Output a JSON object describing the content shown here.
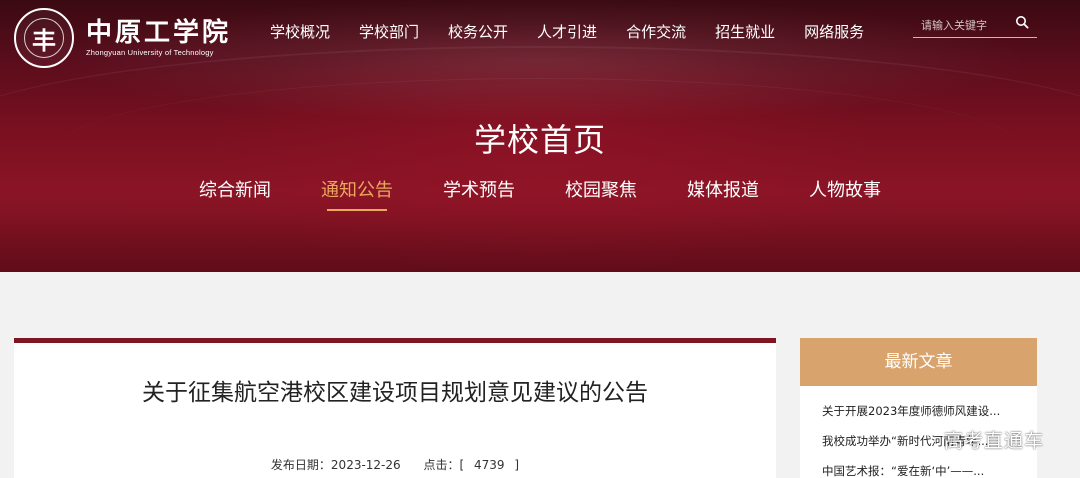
{
  "brand": {
    "emblem_glyph": "丰",
    "name_cn": "中原工学院",
    "name_en": "Zhongyuan University of Technology"
  },
  "topnav": {
    "items": [
      "学校概况",
      "学校部门",
      "校务公开",
      "人才引进",
      "合作交流",
      "招生就业",
      "网络服务"
    ]
  },
  "search": {
    "placeholder": "请输入关键字",
    "icon": "search-icon"
  },
  "banner": {
    "title": "学校首页"
  },
  "subnav": {
    "tabs": [
      "综合新闻",
      "通知公告",
      "学术预告",
      "校园聚焦",
      "媒体报道",
      "人物故事"
    ],
    "active_index": 1
  },
  "article": {
    "title": "关于征集航空港校区建设项目规划意见建议的公告",
    "date_label": "发布日期：2023-12-26",
    "hits_label": "点击：[",
    "hits_value": "4739",
    "hits_close": "]"
  },
  "sidebar": {
    "heading": "最新文章",
    "items": [
      "关于开展2023年度师德师风建设...",
      "我校成功举办“新时代河南青年...",
      "中国艺术报：“爱在新‘中’——..."
    ]
  },
  "watermark": "高考直通车",
  "colors": {
    "brand_red": "#7d1522",
    "accent_gold": "#e8a95c",
    "sidebar_head": "#d8a36d",
    "page_bg": "#f2f2f2"
  }
}
